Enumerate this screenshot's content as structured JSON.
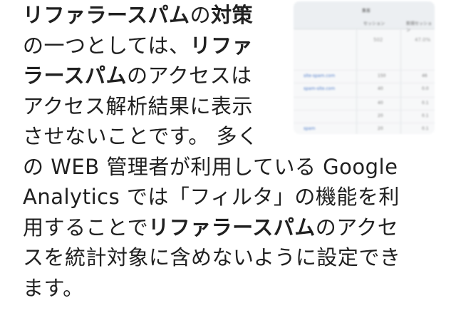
{
  "article": {
    "lines": [
      {
        "segments": [
          {
            "text": "リファラースパム",
            "bold": true
          },
          {
            "text": "の",
            "bold": false
          },
          {
            "text": "対策",
            "bold": true
          }
        ]
      },
      {
        "segments": [
          {
            "text": "の一つとしては、",
            "bold": false
          },
          {
            "text": "リファ",
            "bold": true
          }
        ]
      },
      {
        "segments": [
          {
            "text": "ラースパム",
            "bold": true
          },
          {
            "text": "のアクセスは",
            "bold": false
          }
        ]
      },
      {
        "segments": [
          {
            "text": "アクセス解析結果に表示",
            "bold": false
          }
        ]
      },
      {
        "segments": [
          {
            "text": "させないことです。 多く",
            "bold": false
          }
        ]
      },
      {
        "segments": [
          {
            "text": "の WEB 管理者が利用している Google",
            "bold": false
          }
        ]
      },
      {
        "segments": [
          {
            "text": "Analytics では「フィルタ」の機能を利",
            "bold": false
          }
        ]
      },
      {
        "segments": [
          {
            "text": "用することで",
            "bold": false
          },
          {
            "text": "リファラースパム",
            "bold": true
          },
          {
            "text": "のアクセ",
            "bold": false
          }
        ]
      },
      {
        "segments": [
          {
            "text": "スを統計対象に含めないように設定でき",
            "bold": false
          }
        ]
      },
      {
        "segments": [
          {
            "text": "ます。",
            "bold": false
          }
        ]
      }
    ]
  },
  "thumbnail": {
    "icon": "analytics-table-screenshot",
    "header_group": "集客",
    "col1": "セッション",
    "col2": "新規セッション",
    "totals": [
      "502",
      "47.0%"
    ],
    "rows": [
      {
        "link": "site-spam.com",
        "v1": "150",
        "v3": "46"
      },
      {
        "link": "spam-site.com",
        "v1": "40",
        "v3": "0.0"
      },
      {
        "link": "",
        "v1": "40",
        "v3": "0.1"
      },
      {
        "link": "",
        "v1": "20",
        "v3": "0.1"
      },
      {
        "link": "spam",
        "v1": "20",
        "v3": "0.1"
      }
    ]
  }
}
